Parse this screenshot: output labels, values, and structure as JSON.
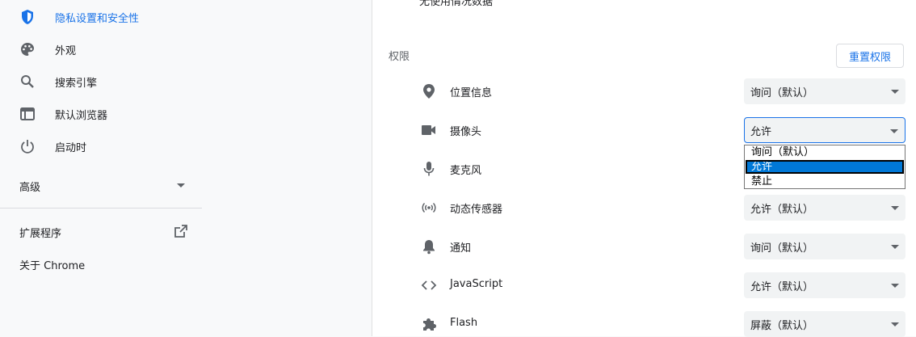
{
  "sidebar": {
    "items": [
      {
        "label": "隐私设置和安全性",
        "icon": "shield-icon",
        "active": true
      },
      {
        "label": "外观",
        "icon": "palette-icon"
      },
      {
        "label": "搜索引擎",
        "icon": "search-icon"
      },
      {
        "label": "默认浏览器",
        "icon": "browser-window-icon"
      },
      {
        "label": "启动时",
        "icon": "power-icon"
      }
    ],
    "advanced_label": "高级",
    "extensions_label": "扩展程序",
    "about_label": "关于 Chrome"
  },
  "main": {
    "top_cut_text": "无使用情况数据",
    "section_title": "权限",
    "reset_button": "重置权限",
    "permissions": [
      {
        "label": "位置信息",
        "icon": "location-pin-icon",
        "value": "询问（默认）"
      },
      {
        "label": "摄像头",
        "icon": "camera-icon",
        "value": "允许"
      },
      {
        "label": "麦克风",
        "icon": "microphone-icon",
        "value": ""
      },
      {
        "label": "动态传感器",
        "icon": "sensors-icon",
        "value": "允许（默认）"
      },
      {
        "label": "通知",
        "icon": "bell-icon",
        "value": "询问（默认）"
      },
      {
        "label": "JavaScript",
        "icon": "code-icon",
        "value": "允许（默认）"
      },
      {
        "label": "Flash",
        "icon": "puzzle-icon",
        "value": "屏蔽（默认）"
      }
    ],
    "camera_dropdown": {
      "options": [
        "询问（默认）",
        "允许",
        "禁止"
      ],
      "highlighted": "允许"
    }
  },
  "colors": {
    "accent": "#1a73e8",
    "sidebar_bg": "#f8f9fa",
    "select_bg": "#f1f3f4",
    "highlight": "#0078d7"
  }
}
